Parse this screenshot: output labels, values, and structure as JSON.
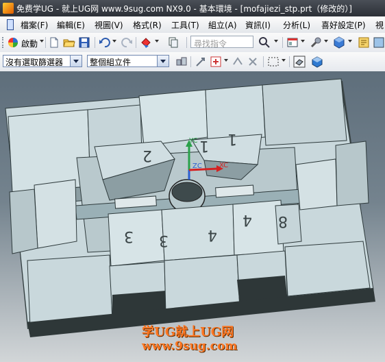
{
  "window": {
    "title": "免费学UG - 就上UG网 www.9sug.com   NX9.0 - 基本環境 - [mofajiezi_stp.prt（修改的）]"
  },
  "menu": [
    {
      "label": "檔案(F)"
    },
    {
      "label": "編輯(E)"
    },
    {
      "label": "視圖(V)"
    },
    {
      "label": "格式(R)"
    },
    {
      "label": "工具(T)"
    },
    {
      "label": "組立(A)"
    },
    {
      "label": "資訊(I)"
    },
    {
      "label": "分析(L)"
    },
    {
      "label": "喜好設定(P)"
    },
    {
      "label": "視"
    }
  ],
  "toolbar": {
    "start_label": "啟動",
    "search_placeholder": "尋找指令"
  },
  "selection_bar": {
    "filter_value": "沒有選取篩選器",
    "scope_value": "整個組立件"
  },
  "viewport": {
    "axis_labels": {
      "y": "YC",
      "z": "ZC",
      "x": "XC"
    },
    "part_labels": [
      "2",
      "1",
      "1",
      "3",
      "3",
      "4",
      "4",
      "8"
    ]
  },
  "watermark": {
    "line1": "学UG就上UG网",
    "line2": "www.9sug.com"
  },
  "colors": {
    "part_fill": "#c9d8dc",
    "part_shadow": "#3a4546",
    "axis_y": "#2aa14a",
    "axis_z": "#2d5fd0",
    "axis_x": "#d42222",
    "watermark": "#ff7722"
  }
}
